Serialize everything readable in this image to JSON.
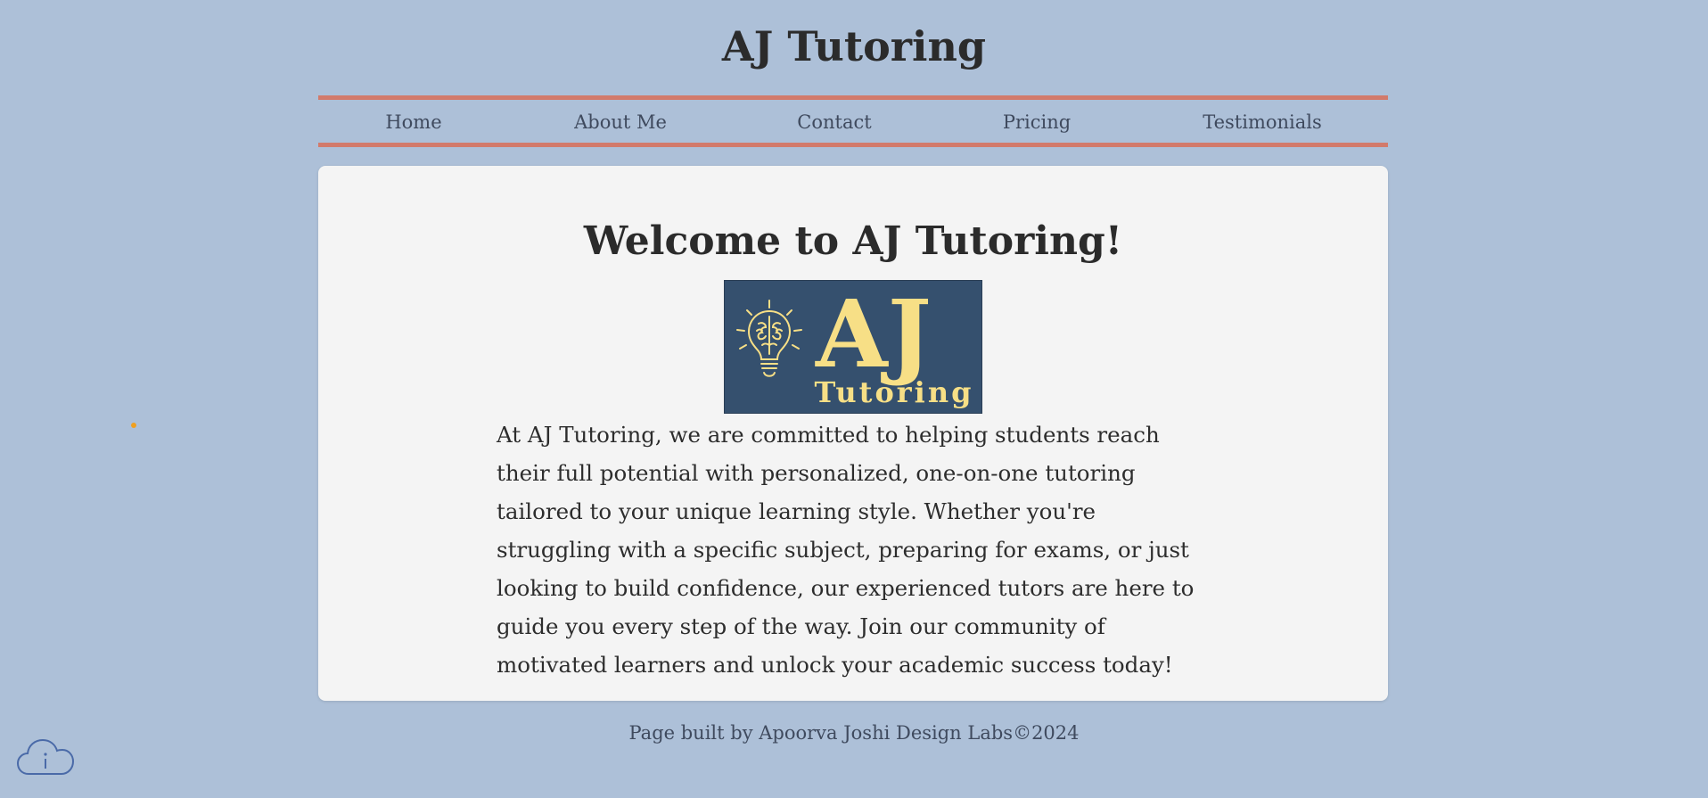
{
  "header": {
    "title": "AJ Tutoring"
  },
  "nav": {
    "items": [
      {
        "label": "Home"
      },
      {
        "label": "About Me"
      },
      {
        "label": "Contact"
      },
      {
        "label": "Pricing"
      },
      {
        "label": "Testimonials"
      }
    ]
  },
  "main": {
    "heading": "Welcome to AJ Tutoring!",
    "logo": {
      "letters": "AJ",
      "subtitle": "Tutoring",
      "icon": "lightbulb-brain-icon"
    },
    "intro": "At AJ Tutoring, we are committed to helping students reach their full potential with personalized, one-on-one tutoring tailored to your unique learning style. Whether you're struggling with a specific subject, preparing for exams, or just looking to build confidence, our experienced tutors are here to guide you every step of the way. Join our community of motivated learners and unlock your academic success today!"
  },
  "footer": {
    "text": "Page built by Apoorva Joshi Design Labs©2024"
  },
  "widgets": {
    "cloud_info_icon": "cloud-info-icon"
  },
  "colors": {
    "background": "#adc0d8",
    "nav_border": "#d27a6b",
    "card": "#f4f4f4",
    "logo_bg": "#35506e",
    "logo_accent": "#f7df86"
  }
}
